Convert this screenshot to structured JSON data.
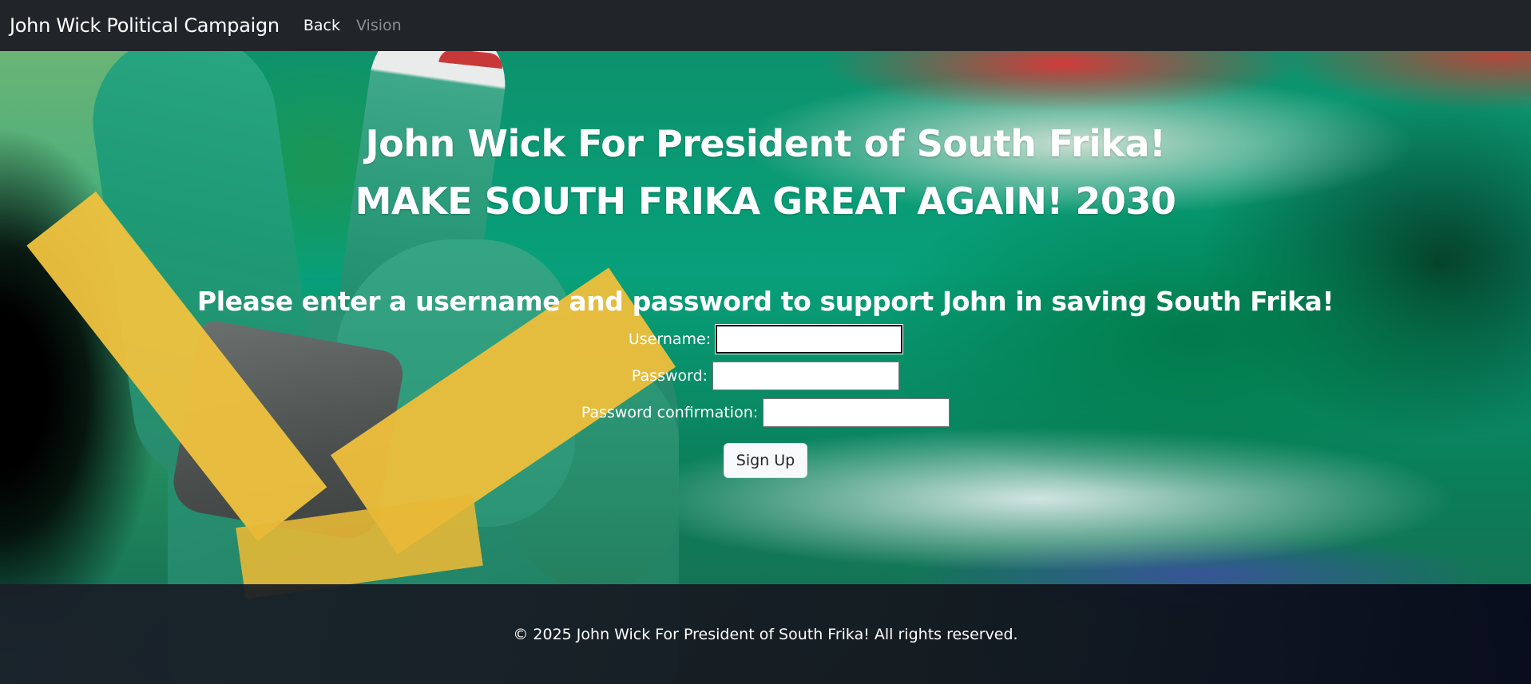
{
  "navbar": {
    "brand": "John Wick Political Campaign",
    "links": [
      {
        "label": "Back",
        "state": "active"
      },
      {
        "label": "Vision",
        "state": "muted"
      }
    ]
  },
  "hero": {
    "headline_line1": "John Wick For President of South Frika!",
    "headline_line2": "MAKE SOUTH FRIKA GREAT AGAIN! 2030",
    "background": "south-africa-flag-peace-sign-hand"
  },
  "form": {
    "prompt": "Please enter a username and password to support John in saving South Frika!",
    "username_label": "Username:",
    "username_value": "",
    "password_label": "Password:",
    "password_value": "",
    "confirm_label": "Password confirmation:",
    "confirm_value": "",
    "submit_label": "Sign Up"
  },
  "footer": {
    "text": "© 2025 John Wick For President of South Frika! All rights reserved."
  },
  "colors": {
    "navbar_bg": "#212529",
    "nav_active": "#ffffff",
    "nav_muted": "#8c9096",
    "button_bg": "#f8f9fa"
  }
}
